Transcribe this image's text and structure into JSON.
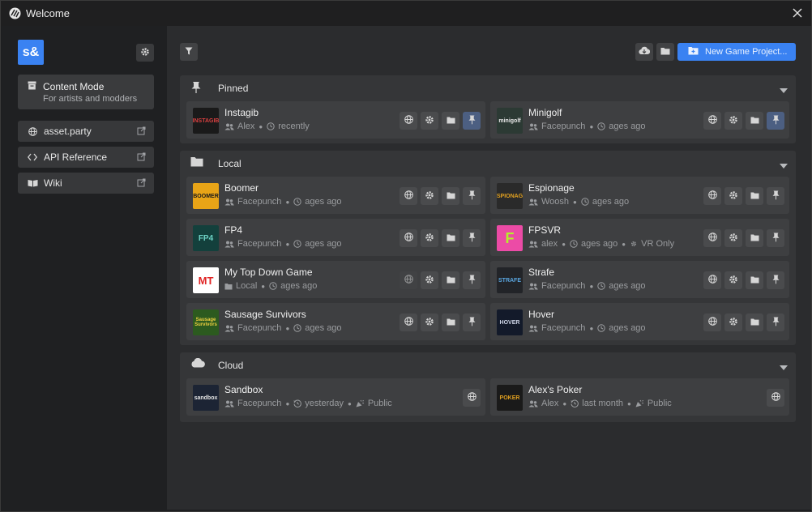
{
  "window": {
    "title": "Welcome"
  },
  "colors": {
    "accent": "#3a82f2",
    "pin_active": "#4c5f82"
  },
  "sidebar": {
    "logo_text": "s&",
    "mode": {
      "title": "Content Mode",
      "subtitle": "For artists and modders"
    },
    "links": [
      {
        "label": "asset.party",
        "icon": "globe-icon"
      },
      {
        "label": "API Reference",
        "icon": "code-icon"
      },
      {
        "label": "Wiki",
        "icon": "book-icon"
      }
    ]
  },
  "toolbar": {
    "new_project_label": "New Game Project..."
  },
  "sections": {
    "pinned": {
      "label": "Pinned"
    },
    "local": {
      "label": "Local"
    },
    "cloud": {
      "label": "Cloud"
    }
  },
  "pinned": [
    {
      "name": "Instagib",
      "thumb": "INSTAGIB",
      "meta": [
        [
          "users-icon",
          "Alex"
        ],
        [
          "clock-icon",
          "recently"
        ]
      ]
    },
    {
      "name": "Minigolf",
      "thumb": "minigolf",
      "meta": [
        [
          "users-icon",
          "Facepunch"
        ],
        [
          "clock-icon",
          "ages ago"
        ]
      ]
    }
  ],
  "local": [
    {
      "name": "Boomer",
      "thumb": "BOOMER",
      "meta": [
        [
          "users-icon",
          "Facepunch"
        ],
        [
          "clock-icon",
          "ages ago"
        ]
      ]
    },
    {
      "name": "Espionage",
      "thumb": "ESPIONAGE",
      "meta": [
        [
          "users-icon",
          "Woosh"
        ],
        [
          "clock-icon",
          "ages ago"
        ]
      ]
    },
    {
      "name": "FP4",
      "thumb": "FP4",
      "meta": [
        [
          "users-icon",
          "Facepunch"
        ],
        [
          "clock-icon",
          "ages ago"
        ]
      ]
    },
    {
      "name": "FPSVR",
      "thumb": "F",
      "meta": [
        [
          "users-icon",
          "alex"
        ],
        [
          "clock-icon",
          "ages ago"
        ],
        [
          "vr-icon",
          "VR Only"
        ]
      ]
    },
    {
      "name": "My Top Down Game",
      "thumb": "MT",
      "meta": [
        [
          "folder-icon",
          "Local"
        ],
        [
          "clock-icon",
          "ages ago"
        ]
      ]
    },
    {
      "name": "Strafe",
      "thumb": "STRAFE",
      "meta": [
        [
          "users-icon",
          "Facepunch"
        ],
        [
          "clock-icon",
          "ages ago"
        ]
      ]
    },
    {
      "name": "Sausage Survivors",
      "thumb": "Sausage Survivors",
      "meta": [
        [
          "users-icon",
          "Facepunch"
        ],
        [
          "clock-icon",
          "ages ago"
        ]
      ]
    },
    {
      "name": "Hover",
      "thumb": "HOVER",
      "meta": [
        [
          "users-icon",
          "Facepunch"
        ],
        [
          "clock-icon",
          "ages ago"
        ]
      ]
    }
  ],
  "cloud": [
    {
      "name": "Sandbox",
      "thumb": "sandbox",
      "meta": [
        [
          "users-icon",
          "Facepunch"
        ],
        [
          "history-icon",
          "yesterday"
        ],
        [
          "public-icon",
          "Public"
        ]
      ]
    },
    {
      "name": "Alex's Poker",
      "thumb": "POKER",
      "meta": [
        [
          "users-icon",
          "Alex"
        ],
        [
          "history-icon",
          "last month"
        ],
        [
          "public-icon",
          "Public"
        ]
      ]
    }
  ]
}
